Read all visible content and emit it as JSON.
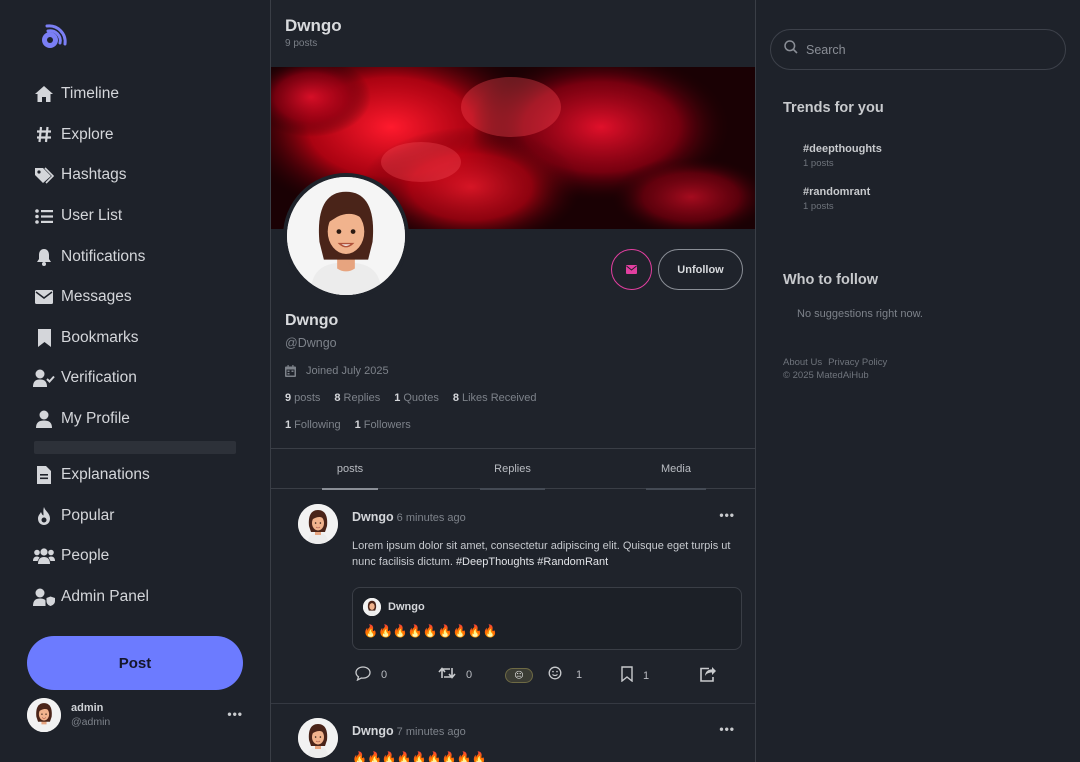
{
  "nav": {
    "items": [
      {
        "label": "Timeline",
        "icon": "home-icon"
      },
      {
        "label": "Explore",
        "icon": "hash-icon"
      },
      {
        "label": "Hashtags",
        "icon": "tags-icon"
      },
      {
        "label": "User List",
        "icon": "list-icon"
      },
      {
        "label": "Notifications",
        "icon": "bell-icon"
      },
      {
        "label": "Messages",
        "icon": "envelope-icon"
      },
      {
        "label": "Bookmarks",
        "icon": "bookmark-icon"
      },
      {
        "label": "Verification",
        "icon": "user-check-icon"
      },
      {
        "label": "My Profile",
        "icon": "user-icon"
      }
    ],
    "items2": [
      {
        "label": "Explanations",
        "icon": "document-icon"
      },
      {
        "label": "Popular",
        "icon": "fire-icon"
      },
      {
        "label": "People",
        "icon": "users-icon"
      },
      {
        "label": "Admin Panel",
        "icon": "user-shield-icon"
      }
    ],
    "post_button": "Post"
  },
  "current_user": {
    "name": "admin",
    "handle": "@admin"
  },
  "profile": {
    "header_name": "Dwngo",
    "header_count": "9 posts",
    "name": "Dwngo",
    "handle": "@Dwngo",
    "joined": "Joined July 2025",
    "unfollow_label": "Unfollow",
    "stats": [
      {
        "value": "9",
        "label": "posts"
      },
      {
        "value": "8",
        "label": "Replies"
      },
      {
        "value": "1",
        "label": "Quotes"
      },
      {
        "value": "8",
        "label": "Likes Received"
      }
    ],
    "follow": [
      {
        "value": "1",
        "label": "Following"
      },
      {
        "value": "1",
        "label": "Followers"
      }
    ]
  },
  "tabs": [
    "posts",
    "Replies",
    "Media"
  ],
  "posts": [
    {
      "author": "Dwngo",
      "time": "6 minutes ago",
      "text": "Lorem ipsum dolor sit amet, consectetur adipiscing elit. Quisque eget turpis ut nunc facilisis dictum.",
      "tags": "#DeepThoughts #RandomRant",
      "quote": {
        "author": "Dwngo",
        "text": "🔥🔥🔥🔥🔥🔥🔥🔥🔥"
      },
      "replies": "0",
      "reposts": "0",
      "reaction": "😐",
      "reactions": "1",
      "bookmarks": "1"
    },
    {
      "author": "Dwngo",
      "time": "7 minutes ago",
      "text": "🔥🔥🔥🔥🔥🔥🔥🔥🔥"
    }
  ],
  "search": {
    "placeholder": "Search"
  },
  "trends": {
    "title": "Trends for you",
    "items": [
      {
        "tag": "#deepthoughts",
        "count": "1 posts"
      },
      {
        "tag": "#randomrant",
        "count": "1 posts"
      }
    ]
  },
  "who_to_follow": {
    "title": "Who to follow",
    "empty": "No suggestions right now."
  },
  "footer": {
    "about": "About Us",
    "privacy": "Privacy Policy",
    "copyright": "© 2025 MatedAiHub"
  },
  "colors": {
    "accent": "#6c7bff",
    "message_ring": "#e23fa0",
    "background": "#1e222a"
  }
}
